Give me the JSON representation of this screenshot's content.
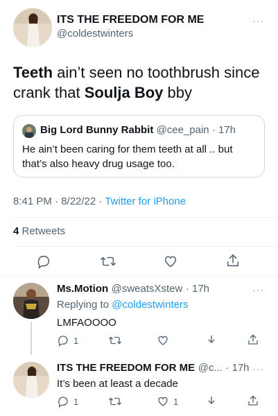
{
  "main_tweet": {
    "display_name": "ITS THE FREEDOM FOR ME",
    "handle": "@coldestwinters",
    "text_part1": "Teeth",
    "text_part2": " ain’t seen no toothbrush since crank that ",
    "text_part3": "Soulja Boy",
    "text_part4": " bby",
    "more": "···",
    "quoted": {
      "display_name": "Big Lord Bunny Rabbit",
      "handle": "@cee_pain",
      "time": "· 17h",
      "text": "He ain’t been caring for them teeth at all .. but that’s also heavy drug usage too."
    },
    "timestamp": "8:41 PM · 8/22/22 · ",
    "source": "Twitter for iPhone",
    "retweets_count": "4",
    "retweets_label": " Retweets",
    "actions": [
      "reply-icon",
      "retweet-icon",
      "like-icon",
      "share-icon"
    ]
  },
  "replies": [
    {
      "display_name": "Ms.Motion",
      "handle": "@sweatsXstew",
      "time": "· 17h",
      "replying_prefix": "Replying to ",
      "replying_to": "@coldestwinters",
      "text": "LMFAOOOO",
      "reply_count": "1",
      "retweet_count": "",
      "like_count": ""
    },
    {
      "display_name": "ITS THE FREEDOM FOR ME",
      "handle": "@c...",
      "time": "· 17h",
      "text": "It’s been at least a decade",
      "reply_count": "1",
      "retweet_count": "",
      "like_count": "1"
    }
  ],
  "colors": {
    "link": "#1d9bf0",
    "secondary_text": "#536471",
    "border": "#cfd9de"
  }
}
